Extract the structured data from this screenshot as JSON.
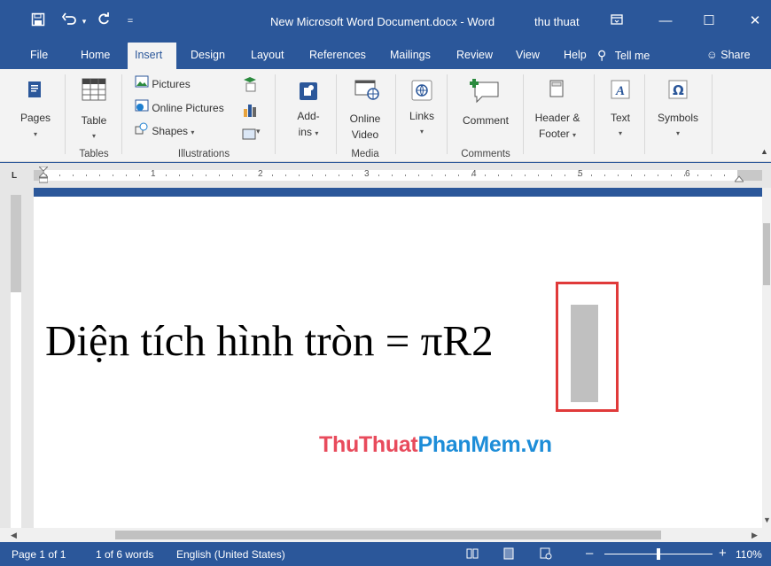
{
  "titlebar": {
    "doc_title": "New Microsoft Word Document.docx - Word",
    "user": "thu thuat",
    "save_icon": "save-icon",
    "undo_icon": "undo-icon",
    "redo_icon": "redo-icon"
  },
  "tabs": [
    "File",
    "Home",
    "Insert",
    "Design",
    "Layout",
    "References",
    "Mailings",
    "Review",
    "View",
    "Help"
  ],
  "active_tab": "Insert",
  "tellme": "Tell me",
  "share": "Share",
  "ribbon": {
    "pages": "Pages",
    "table": "Table",
    "tables_group": "Tables",
    "pictures": "Pictures",
    "online_pictures": "Online Pictures",
    "shapes": "Shapes",
    "illustrations_group": "Illustrations",
    "addins_1": "Add-",
    "addins_2": "ins",
    "online_video_1": "Online",
    "online_video_2": "Video",
    "media_group": "Media",
    "links": "Links",
    "comment": "Comment",
    "comments_group": "Comments",
    "header_footer_1": "Header &",
    "header_footer_2": "Footer",
    "text": "Text",
    "symbols": "Symbols"
  },
  "ruler_numbers": [
    "1",
    "2",
    "3",
    "4",
    "5",
    "6"
  ],
  "document": {
    "text": "Diện tích hình tròn = πR2",
    "watermark_a": "ThuThuat",
    "watermark_b": "PhanMem.vn"
  },
  "status": {
    "page": "Page 1 of 1",
    "words": "1 of 6 words",
    "language": "English (United States)",
    "zoom": "110%"
  },
  "colors": {
    "brand": "#2b579a",
    "highlight_border": "#e03a3a",
    "watermark_red": "#e84b5c",
    "watermark_blue": "#1d8dd8"
  }
}
